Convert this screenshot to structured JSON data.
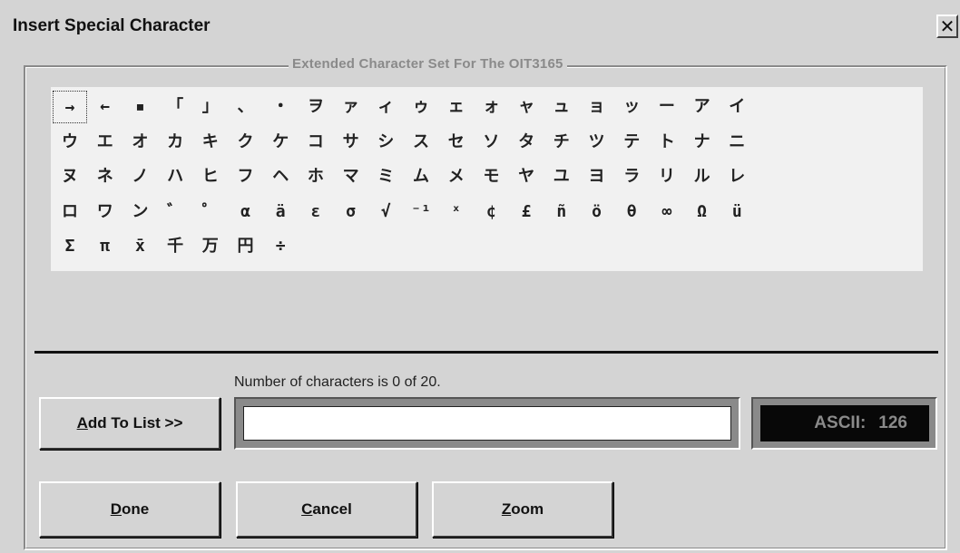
{
  "window": {
    "title": "Insert Special Character",
    "close_label": "✕"
  },
  "group": {
    "legend": "Extended Character Set For The OIT3165"
  },
  "characters": [
    [
      "→",
      "←",
      "▪",
      "「",
      "」",
      "、",
      "・",
      "ヲ",
      "ァ",
      "ィ",
      "ゥ",
      "ェ",
      "ォ",
      "ャ",
      "ュ",
      "ョ",
      "ッ",
      "ー",
      "ア",
      "イ"
    ],
    [
      "ウ",
      "エ",
      "オ",
      "カ",
      "キ",
      "ク",
      "ケ",
      "コ",
      "サ",
      "シ",
      "ス",
      "セ",
      "ソ",
      "タ",
      "チ",
      "ツ",
      "テ",
      "ト",
      "ナ",
      "ニ"
    ],
    [
      "ヌ",
      "ネ",
      "ノ",
      "ハ",
      "ヒ",
      "フ",
      "ヘ",
      "ホ",
      "マ",
      "ミ",
      "ム",
      "メ",
      "モ",
      "ヤ",
      "ユ",
      "ヨ",
      "ラ",
      "リ",
      "ル",
      "レ"
    ],
    [
      "ロ",
      "ワ",
      "ン",
      "゛",
      "゜",
      "α",
      "ä",
      "ε",
      "σ",
      "√",
      "⁻¹",
      "ˣ",
      "¢",
      "£",
      "ñ",
      "ö",
      "θ",
      "∞",
      "Ω",
      "ü"
    ],
    [
      "Σ",
      "π",
      "x̄",
      "千",
      "万",
      "円",
      "÷"
    ]
  ],
  "selected_character": {
    "row": 0,
    "col": 0
  },
  "count_text": "Number of characters is 0 of 20.",
  "buttons": {
    "add_to_list": {
      "mnemonic": "A",
      "rest": "dd To List >>"
    },
    "done": {
      "mnemonic": "D",
      "rest": "one"
    },
    "cancel": {
      "mnemonic": "C",
      "rest": "ancel"
    },
    "zoom": {
      "mnemonic": "Z",
      "rest": "oom"
    }
  },
  "entry": {
    "value": ""
  },
  "ascii": {
    "label": "ASCII:",
    "value": "126"
  },
  "colors": {
    "window_bg": "#d4d4d4",
    "grid_bg": "#f1f1f1",
    "ascii_bg": "#080808",
    "ascii_text": "#8a8a8a",
    "legend_text": "#8a8a8a"
  }
}
